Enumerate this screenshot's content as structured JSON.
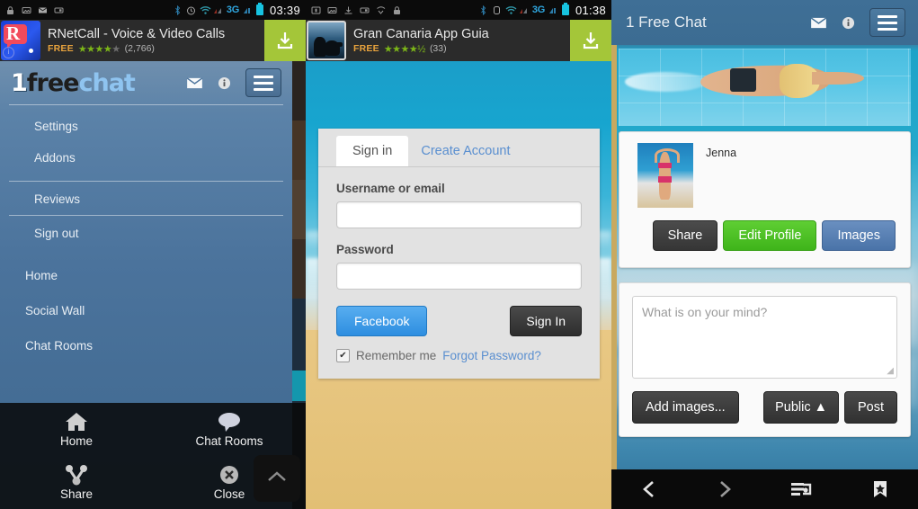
{
  "panels": {
    "left": {
      "statusbar": {
        "time": "03:39",
        "network": "3G",
        "icons": [
          "lock-icon",
          "screenshot-icon",
          "mail-icon",
          "sdcard-icon",
          "bluetooth-icon",
          "alarm-icon",
          "wifi-icon",
          "signal-icon",
          "battery-icon"
        ]
      },
      "ad": {
        "title": "RNetCall - Voice & Video Calls",
        "free_label": "FREE",
        "rating": 4,
        "rating_count": "(2,766)",
        "download_icon": "download-icon"
      },
      "app": {
        "logo_a": "1",
        "logo_b": "free",
        "logo_c": "chat",
        "mail_icon": "envelope-icon",
        "info_icon": "info-icon",
        "menu_icon": "hamburger-icon"
      },
      "menu": [
        {
          "label": "Settings"
        },
        {
          "label": "Addons"
        },
        {
          "label": "Reviews"
        },
        {
          "label": "Sign out"
        },
        {
          "label": "Home"
        },
        {
          "label": "Social Wall"
        },
        {
          "label": "Chat Rooms"
        }
      ],
      "overlay": [
        {
          "label": "Home",
          "icon": "home-icon"
        },
        {
          "label": "Chat Rooms",
          "icon": "chat-bubble-icon"
        },
        {
          "label": "Share",
          "icon": "share-icon"
        },
        {
          "label": "Close",
          "icon": "close-circle-icon"
        }
      ],
      "scroll_top_icon": "chevron-up-icon"
    },
    "middle": {
      "statusbar": {
        "time": "01:38",
        "network": "3G",
        "icons": [
          "mic-icon",
          "screenshot-icon",
          "download-icon",
          "sdcard-icon",
          "missed-call-icon",
          "lock-icon",
          "bluetooth-icon",
          "silent-icon",
          "wifi-icon",
          "signal-icon",
          "battery-icon"
        ]
      },
      "ad": {
        "title": "Gran Canaria App Guia",
        "free_label": "FREE",
        "rating": 4.5,
        "rating_count": "(33)",
        "download_icon": "download-icon"
      },
      "form": {
        "tab_signin": "Sign in",
        "tab_create": "Create Account",
        "username_label": "Username or email",
        "username_value": "",
        "username_placeholder": "",
        "password_label": "Password",
        "password_value": "",
        "password_placeholder": "",
        "facebook_button": "Facebook",
        "signin_button": "Sign In",
        "remember_label": "Remember me",
        "remember_checked": true,
        "forgot_link": "Forgot Password?"
      }
    },
    "right": {
      "header": {
        "title": "1 Free Chat",
        "mail_icon": "envelope-icon",
        "info_icon": "info-icon",
        "menu_icon": "hamburger-icon"
      },
      "banner_icon": "swimmer-banner-image",
      "profile": {
        "name": "Jenna",
        "avatar_icon": "profile-avatar-image",
        "buttons": [
          {
            "label": "Share",
            "name": "share-button"
          },
          {
            "label": "Edit Profile",
            "name": "edit-profile-button"
          },
          {
            "label": "Images",
            "name": "images-button"
          }
        ]
      },
      "composer": {
        "placeholder": "What is on your mind?",
        "value": "",
        "add_images_button": "Add images...",
        "privacy_button": "Public",
        "privacy_caret": "▲",
        "post_button": "Post"
      },
      "navbar": [
        {
          "name": "nav-back",
          "icon": "chevron-left-icon"
        },
        {
          "name": "nav-forward",
          "icon": "chevron-right-icon"
        },
        {
          "name": "nav-tabs",
          "icon": "tabs-icon"
        },
        {
          "name": "nav-bookmarks",
          "icon": "bookmark-star-icon"
        }
      ]
    }
  },
  "colors": {
    "android_green": "#a4c639",
    "sidebar_blue": "#4b739c",
    "facebook_blue": "#2d8ee0",
    "edit_green": "#3fb41a",
    "images_blue": "#4a73a8",
    "link_blue": "#5a8fd0",
    "teal": "#1497ad"
  }
}
